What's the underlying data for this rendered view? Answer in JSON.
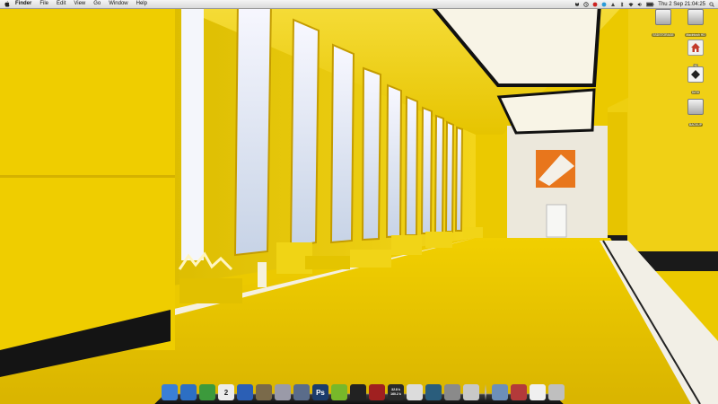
{
  "menubar": {
    "apple_icon": "apple-logo-icon",
    "app_name": "Finder",
    "menus": [
      "File",
      "Edit",
      "View",
      "Go",
      "Window",
      "Help"
    ],
    "status_icons": [
      "dropbox-icon",
      "time-machine-icon",
      "adium-icon",
      "skype-icon",
      "growl-icon",
      "bluetooth-icon",
      "wifi-icon",
      "volume-icon",
      "battery-icon"
    ],
    "clock": "Thu 2 Sep 21:04:25",
    "spotlight_icon": "spotlight-icon"
  },
  "desktop_icons": [
    {
      "label": "SSDSTORAGE",
      "icon": "hard-drive-icon"
    },
    {
      "label": "Macintosh HD",
      "icon": "hard-drive-icon"
    },
    {
      "label": "HD",
      "icon": "home-folder-icon"
    },
    {
      "label": "DATA",
      "icon": "drive-icon"
    },
    {
      "label": "BACKUP",
      "icon": "hard-drive-icon"
    }
  ],
  "dock": {
    "apps": [
      {
        "name": "Finder",
        "icon": "finder-icon",
        "color": "#3a7fd6",
        "glyph": ""
      },
      {
        "name": "Safari",
        "icon": "safari-icon",
        "color": "#2d6fc4",
        "glyph": ""
      },
      {
        "name": "Adium",
        "icon": "adium-icon",
        "color": "#3c9a3c",
        "glyph": ""
      },
      {
        "name": "iCal",
        "icon": "ical-icon",
        "color": "#ececec",
        "glyph": "2"
      },
      {
        "name": "iTunes",
        "icon": "itunes-icon",
        "color": "#2b5fb5",
        "glyph": ""
      },
      {
        "name": "iPhoto",
        "icon": "iphoto-icon",
        "color": "#7a6a4a",
        "glyph": ""
      },
      {
        "name": "Preview",
        "icon": "preview-icon",
        "color": "#9a9aa8",
        "glyph": ""
      },
      {
        "name": "Pages",
        "icon": "pages-icon",
        "color": "#5a6c8a",
        "glyph": ""
      },
      {
        "name": "Photoshop",
        "icon": "photoshop-icon",
        "color": "#1b3c6b",
        "glyph": "Ps"
      },
      {
        "name": "Spotify",
        "icon": "spotify-icon",
        "color": "#77b82a",
        "glyph": ""
      },
      {
        "name": "Terminal",
        "icon": "terminal-icon",
        "color": "#222222",
        "glyph": ""
      },
      {
        "name": "Transmission",
        "icon": "transmission-icon",
        "color": "#a02020",
        "glyph": ""
      },
      {
        "name": "Network Monitor",
        "icon": "network-monitor-icon",
        "color": "#2a2a2a",
        "glyph": "",
        "up": "32.8 k",
        "down": "160.2 k"
      },
      {
        "name": "TextEdit",
        "icon": "textedit-icon",
        "color": "#dcdcdc",
        "glyph": ""
      },
      {
        "name": "Time Machine",
        "icon": "time-machine-icon",
        "color": "#2a5d7c",
        "glyph": ""
      },
      {
        "name": "System Preferences",
        "icon": "system-preferences-icon",
        "color": "#8a8a8a",
        "glyph": ""
      },
      {
        "name": "Script Editor",
        "icon": "script-editor-icon",
        "color": "#c8c8c8",
        "glyph": ""
      }
    ],
    "stacks": [
      {
        "name": "Applications",
        "icon": "applications-folder-icon",
        "color": "#6d8fb8"
      },
      {
        "name": "Downloads",
        "icon": "downloads-stack-icon",
        "color": "#b33a3a"
      },
      {
        "name": "Documents",
        "icon": "documents-stack-icon",
        "color": "#f0f0f0"
      },
      {
        "name": "Trash",
        "icon": "trash-icon",
        "color": "#bfbfbf"
      }
    ]
  }
}
